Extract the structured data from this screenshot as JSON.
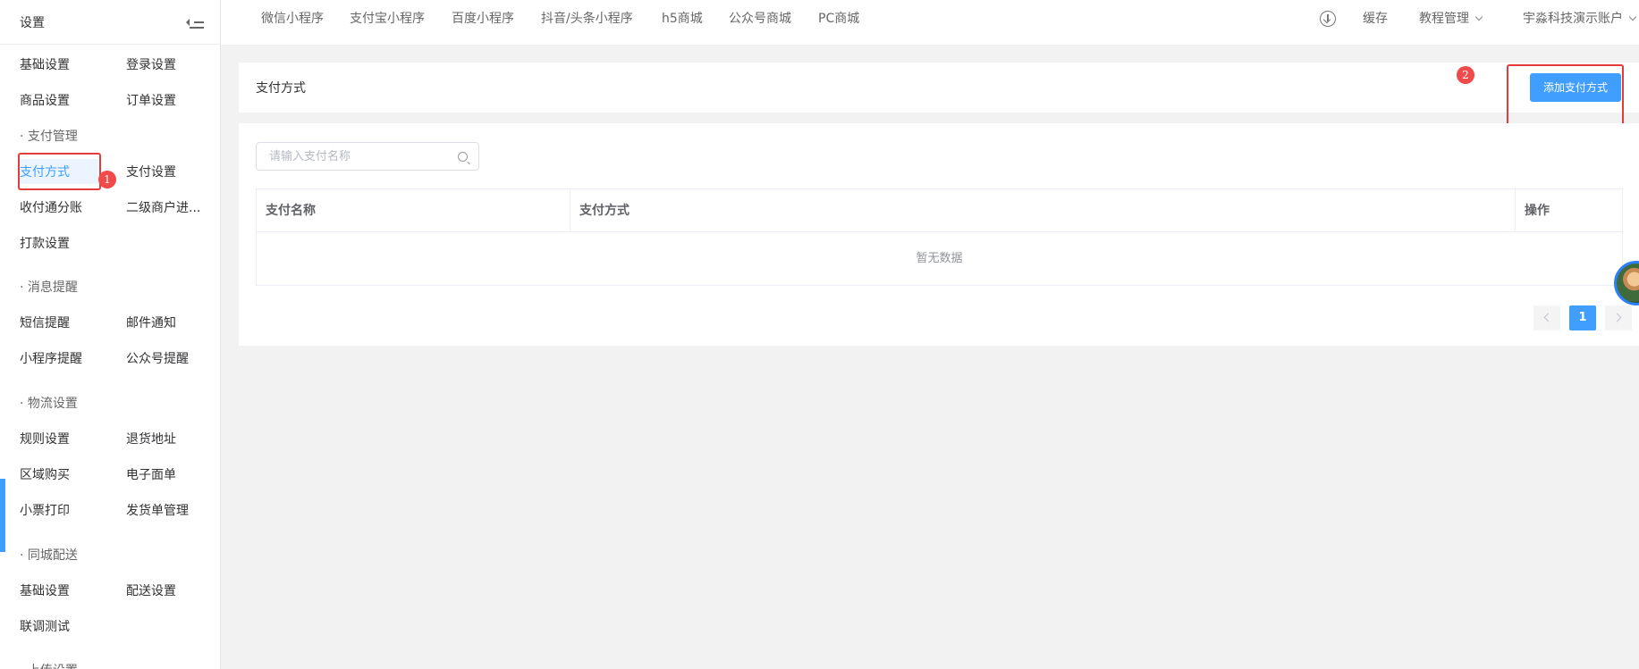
{
  "sidebar": {
    "title": "设置",
    "groups": {
      "basic": {
        "items": [
          "基础设置",
          "登录设置",
          "商品设置",
          "订单设置"
        ]
      },
      "payment": {
        "label": "· 支付管理",
        "items": [
          "支付方式",
          "支付设置",
          "收付通分账",
          "二级商户进...",
          "打款设置"
        ]
      },
      "message": {
        "label": "· 消息提醒",
        "items": [
          "短信提醒",
          "邮件通知",
          "小程序提醒",
          "公众号提醒"
        ]
      },
      "logistics": {
        "label": "· 物流设置",
        "items": [
          "规则设置",
          "退货地址",
          "区域购买",
          "电子面单",
          "小票打印",
          "发货单管理"
        ]
      },
      "local": {
        "label": "· 同城配送",
        "items": [
          "基础设置",
          "配送设置",
          "联调测试"
        ]
      },
      "upload": {
        "label": "· 上传设置"
      }
    }
  },
  "topnav": {
    "items": [
      "微信小程序",
      "支付宝小程序",
      "百度小程序",
      "抖音/头条小程序",
      "h5商城",
      "公众号商城",
      "PC商城"
    ],
    "cache": "缓存",
    "tutorial": "教程管理",
    "account": "宇淼科技演示账户"
  },
  "main": {
    "section_title": "支付方式",
    "add_button": "添加支付方式",
    "search_placeholder": "请输入支付名称",
    "table": {
      "columns": [
        "支付名称",
        "支付方式",
        "操作"
      ],
      "empty_text": "暂无数据"
    },
    "pagination": {
      "current": "1"
    }
  },
  "annotations": [
    "1",
    "2"
  ],
  "colors": {
    "primary": "#409eff",
    "annotation": "#e63b3b"
  }
}
